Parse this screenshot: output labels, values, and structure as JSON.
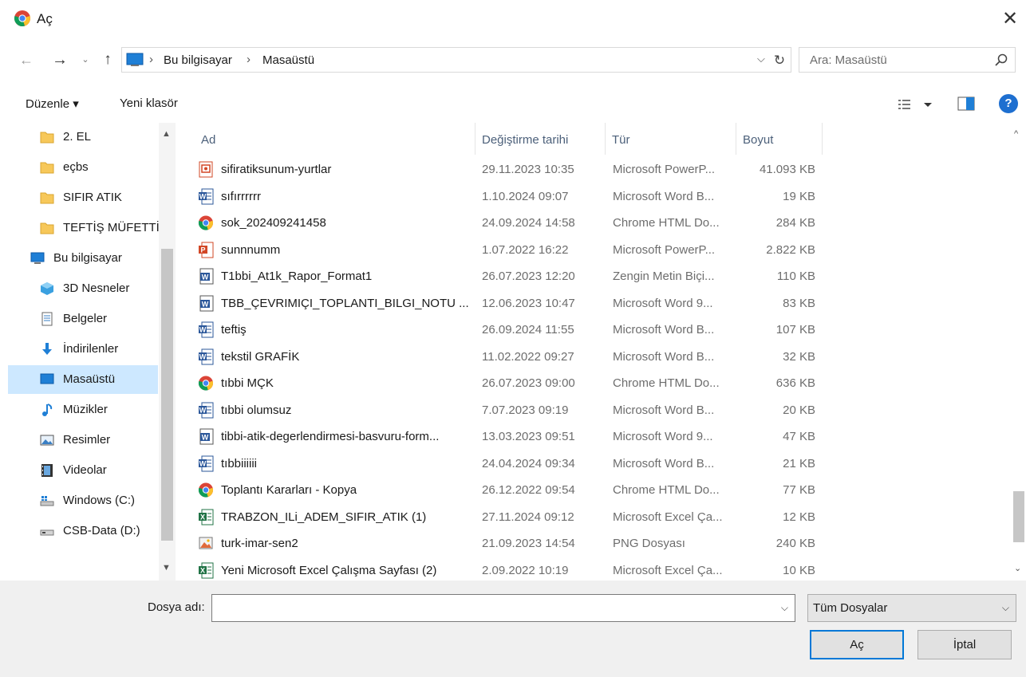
{
  "window": {
    "title": "Aç",
    "close_glyph": "✕"
  },
  "nav": {
    "back": "←",
    "forward": "→",
    "recent": "⌄",
    "up": "↑",
    "breadcrumb": [
      "Bu bilgisayar",
      "Masaüstü"
    ],
    "refresh": "↻",
    "search_placeholder": "Ara: Masaüstü"
  },
  "toolbar": {
    "organize": "Düzenle ▾",
    "new_folder": "Yeni klasör",
    "help": "?"
  },
  "sidebar": {
    "items": [
      {
        "label": "2. EL",
        "icon": "folder-icon",
        "indent": 1
      },
      {
        "label": "eçbs",
        "icon": "folder-icon",
        "indent": 1
      },
      {
        "label": "SIFIR ATIK",
        "icon": "folder-icon",
        "indent": 1
      },
      {
        "label": "TEFTİŞ MÜFETTİ",
        "icon": "folder-icon",
        "indent": 1
      },
      {
        "label": "Bu bilgisayar",
        "icon": "computer-icon",
        "indent": 0
      },
      {
        "label": "3D Nesneler",
        "icon": "3d-objects-icon",
        "indent": 1
      },
      {
        "label": "Belgeler",
        "icon": "documents-icon",
        "indent": 1
      },
      {
        "label": "İndirilenler",
        "icon": "downloads-icon",
        "indent": 1
      },
      {
        "label": "Masaüstü",
        "icon": "desktop-icon",
        "indent": 1,
        "selected": true
      },
      {
        "label": "Müzikler",
        "icon": "music-icon",
        "indent": 1
      },
      {
        "label": "Resimler",
        "icon": "pictures-icon",
        "indent": 1
      },
      {
        "label": "Videolar",
        "icon": "videos-icon",
        "indent": 1
      },
      {
        "label": "Windows (C:)",
        "icon": "drive-c-icon",
        "indent": 1
      },
      {
        "label": "CSB-Data (D:)",
        "icon": "drive-d-icon",
        "indent": 1
      }
    ]
  },
  "columns": [
    "Ad",
    "Değiştirme tarihi",
    "Tür",
    "Boyut"
  ],
  "files": [
    {
      "name": "sifiratiksunum-yurtlar",
      "date": "29.11.2023 10:35",
      "type": "Microsoft PowerP...",
      "size": "41.093 KB",
      "icon": "pdf-presentation-icon"
    },
    {
      "name": "sıfırrrrrr",
      "date": "1.10.2024 09:07",
      "type": "Microsoft Word B...",
      "size": "19 KB",
      "icon": "word-document-icon"
    },
    {
      "name": "sok_202409241458",
      "date": "24.09.2024 14:58",
      "type": "Chrome HTML Do...",
      "size": "284 KB",
      "icon": "chrome-html-icon"
    },
    {
      "name": "sunnnumm",
      "date": "1.07.2022 16:22",
      "type": "Microsoft PowerP...",
      "size": "2.822 KB",
      "icon": "powerpoint-icon"
    },
    {
      "name": "T1bbi_At1k_Rapor_Format1",
      "date": "26.07.2023 12:20",
      "type": "Zengin Metin Biçi...",
      "size": "110 KB",
      "icon": "word-legacy-icon"
    },
    {
      "name": "TBB_ÇEVRIMIÇI_TOPLANTI_BILGI_NOTU ...",
      "date": "12.06.2023 10:47",
      "type": "Microsoft Word 9...",
      "size": "83 KB",
      "icon": "word-legacy-icon"
    },
    {
      "name": "teftiş",
      "date": "26.09.2024 11:55",
      "type": "Microsoft Word B...",
      "size": "107 KB",
      "icon": "word-document-icon"
    },
    {
      "name": "tekstil GRAFİK",
      "date": "11.02.2022 09:27",
      "type": "Microsoft Word B...",
      "size": "32 KB",
      "icon": "word-document-icon"
    },
    {
      "name": "tıbbi MÇK",
      "date": "26.07.2023 09:00",
      "type": "Chrome HTML Do...",
      "size": "636 KB",
      "icon": "chrome-html-icon"
    },
    {
      "name": "tıbbi olumsuz",
      "date": "7.07.2023 09:19",
      "type": "Microsoft Word B...",
      "size": "20 KB",
      "icon": "word-document-icon"
    },
    {
      "name": "tibbi-atik-degerlendirmesi-basvuru-form...",
      "date": "13.03.2023 09:51",
      "type": "Microsoft Word 9...",
      "size": "47 KB",
      "icon": "word-legacy-icon"
    },
    {
      "name": "tıbbiiiiii",
      "date": "24.04.2024 09:34",
      "type": "Microsoft Word B...",
      "size": "21 KB",
      "icon": "word-document-icon"
    },
    {
      "name": "Toplantı Kararları - Kopya",
      "date": "26.12.2022 09:54",
      "type": "Chrome HTML Do...",
      "size": "77 KB",
      "icon": "chrome-html-icon"
    },
    {
      "name": "TRABZON_ILi_ADEM_SIFIR_ATIK (1)",
      "date": "27.11.2024 09:12",
      "type": "Microsoft Excel Ça...",
      "size": "12 KB",
      "icon": "excel-icon"
    },
    {
      "name": "turk-imar-sen2",
      "date": "21.09.2023 14:54",
      "type": "PNG Dosyası",
      "size": "240 KB",
      "icon": "image-png-icon"
    },
    {
      "name": "Yeni Microsoft Excel Çalışma Sayfası (2)",
      "date": "2.09.2022 10:19",
      "type": "Microsoft Excel Ça...",
      "size": "10 KB",
      "icon": "excel-icon"
    }
  ],
  "footer": {
    "filename_label": "Dosya adı:",
    "filename_value": "",
    "filetype": "Tüm Dosyalar",
    "open": "Aç",
    "cancel": "İptal"
  },
  "colors": {
    "accent": "#0078d7",
    "selected_bg": "#cde8ff",
    "header_text": "#4c607a"
  }
}
